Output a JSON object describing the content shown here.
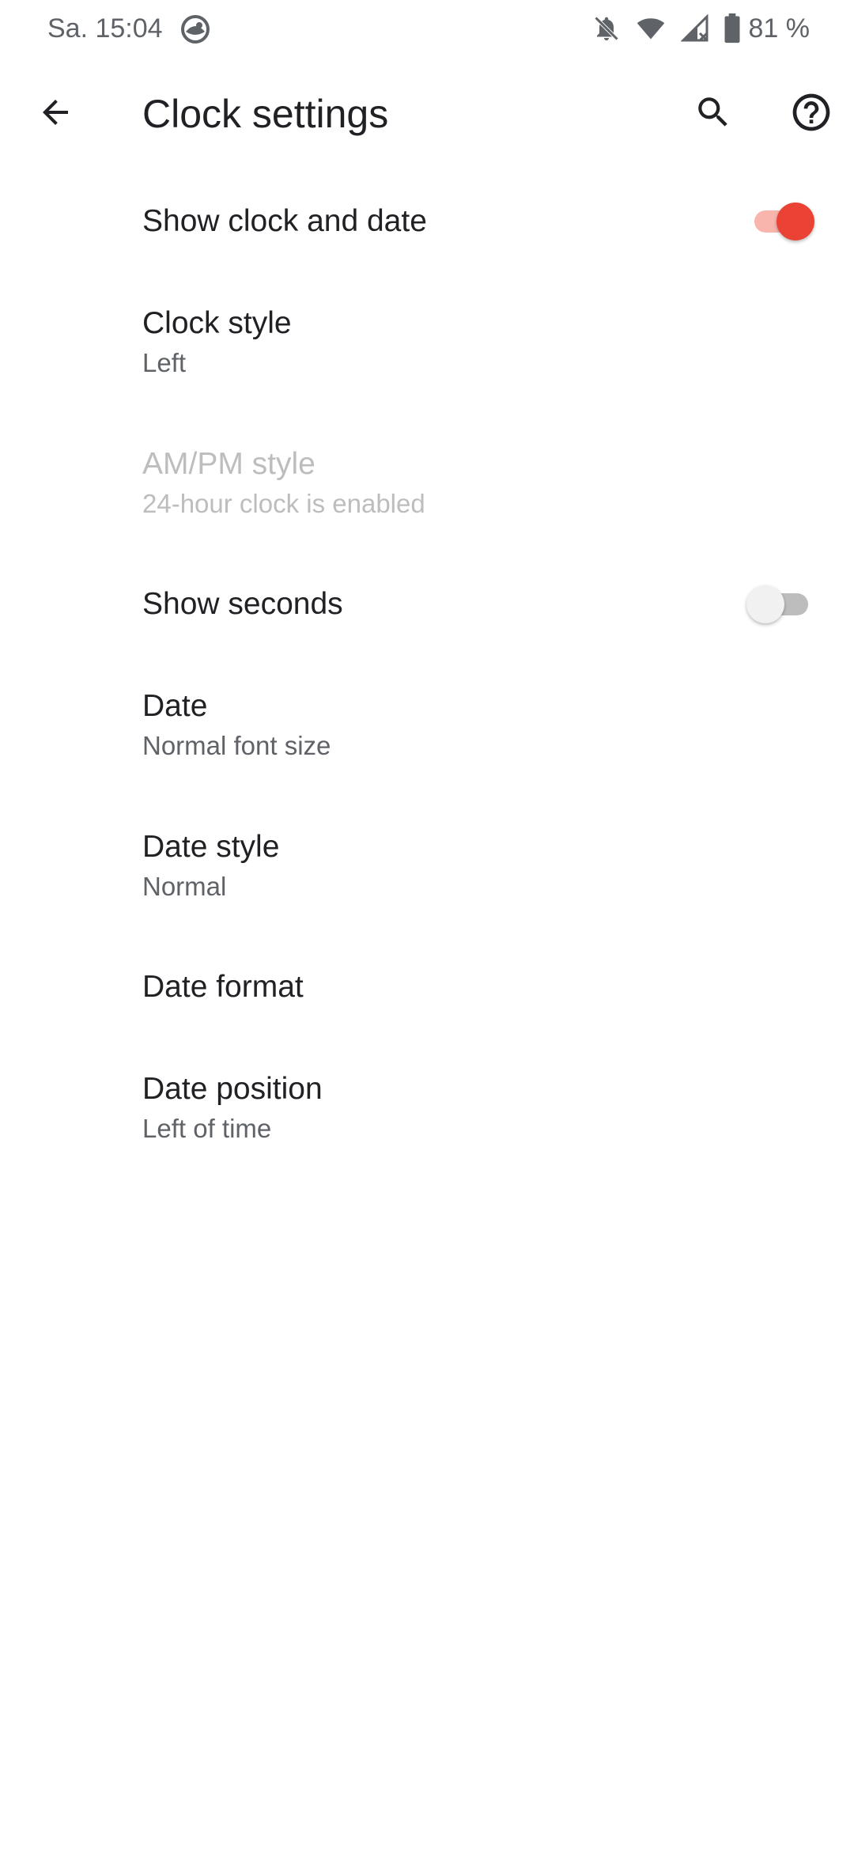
{
  "status_bar": {
    "time": "Sa. 15:04",
    "battery_percent": "81 %",
    "icons": [
      "app-notification-icon",
      "bell-off-icon",
      "wifi-icon",
      "cell-signal-icon",
      "battery-icon"
    ]
  },
  "app_bar": {
    "title": "Clock settings",
    "back_icon": "arrow-back-icon",
    "search_icon": "search-icon",
    "help_icon": "help-circle-icon"
  },
  "settings": {
    "show_clock_and_date": {
      "title": "Show clock and date",
      "enabled": true
    },
    "clock_style": {
      "title": "Clock style",
      "summary": "Left"
    },
    "ampm_style": {
      "title": "AM/PM style",
      "summary": "24-hour clock is enabled",
      "disabled": true
    },
    "show_seconds": {
      "title": "Show seconds",
      "enabled": false
    },
    "date": {
      "title": "Date",
      "summary": "Normal font size"
    },
    "date_style": {
      "title": "Date style",
      "summary": "Normal"
    },
    "date_format": {
      "title": "Date format"
    },
    "date_position": {
      "title": "Date position",
      "summary": "Left of time"
    }
  },
  "colors": {
    "accent": "#ea4335",
    "accent_track": "#f8b5ae",
    "text_primary": "#202124",
    "text_secondary": "#5f6368",
    "text_disabled": "#bdbdbd"
  }
}
